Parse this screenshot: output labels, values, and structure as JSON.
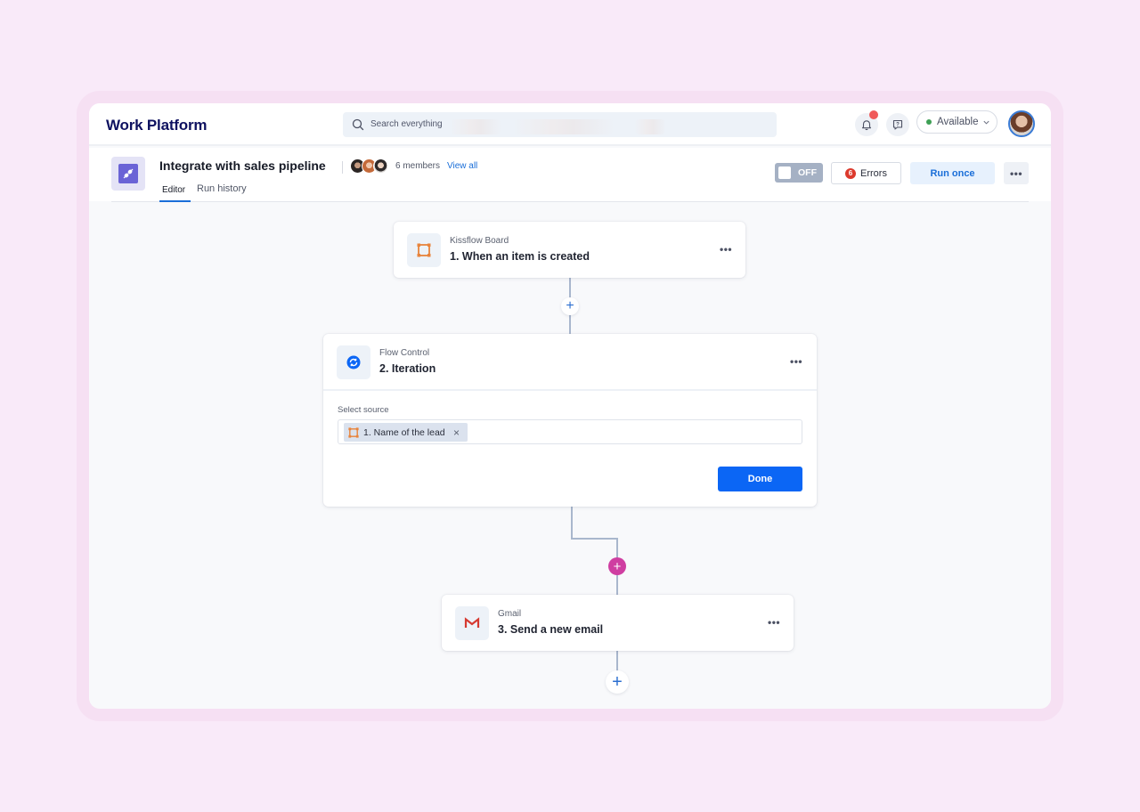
{
  "app": {
    "brand": "Work Platform",
    "search": {
      "placeholder": "Search everything"
    },
    "status": {
      "label": "Available",
      "color": "#3ea055"
    },
    "notifications": {
      "has_unread": true
    }
  },
  "header": {
    "title": "Integrate with sales pipeline",
    "members_count": "6 members",
    "view_all": "View all",
    "tabs": [
      {
        "label": "Editor",
        "active": true
      },
      {
        "label": "Run history",
        "active": false
      }
    ],
    "toggle": {
      "label": "OFF",
      "state": "off"
    },
    "errors": {
      "count": "6",
      "label": "Errors"
    },
    "run_once": "Run once",
    "more": "•••"
  },
  "flow": {
    "steps": [
      {
        "app": "Kissflow Board",
        "title": "1. When an item is created",
        "icon": "kissflow-board-icon"
      },
      {
        "app": "Flow Control",
        "title": "2. Iteration",
        "icon": "iteration-icon",
        "expanded": true,
        "field_label": "Select source",
        "selected_chip": "1. Name of the lead",
        "chip_remove": "×",
        "done_label": "Done"
      },
      {
        "app": "Gmail",
        "title": "3. Send a new email",
        "icon": "gmail-icon"
      }
    ],
    "more_label": "•••",
    "add_label": "+"
  },
  "colors": {
    "brand": "#0e1160",
    "accent": "#1a6ed8",
    "primary_button": "#0b66f5",
    "error": "#dc3a2d",
    "connector_add_active": "#cf3ea1"
  }
}
